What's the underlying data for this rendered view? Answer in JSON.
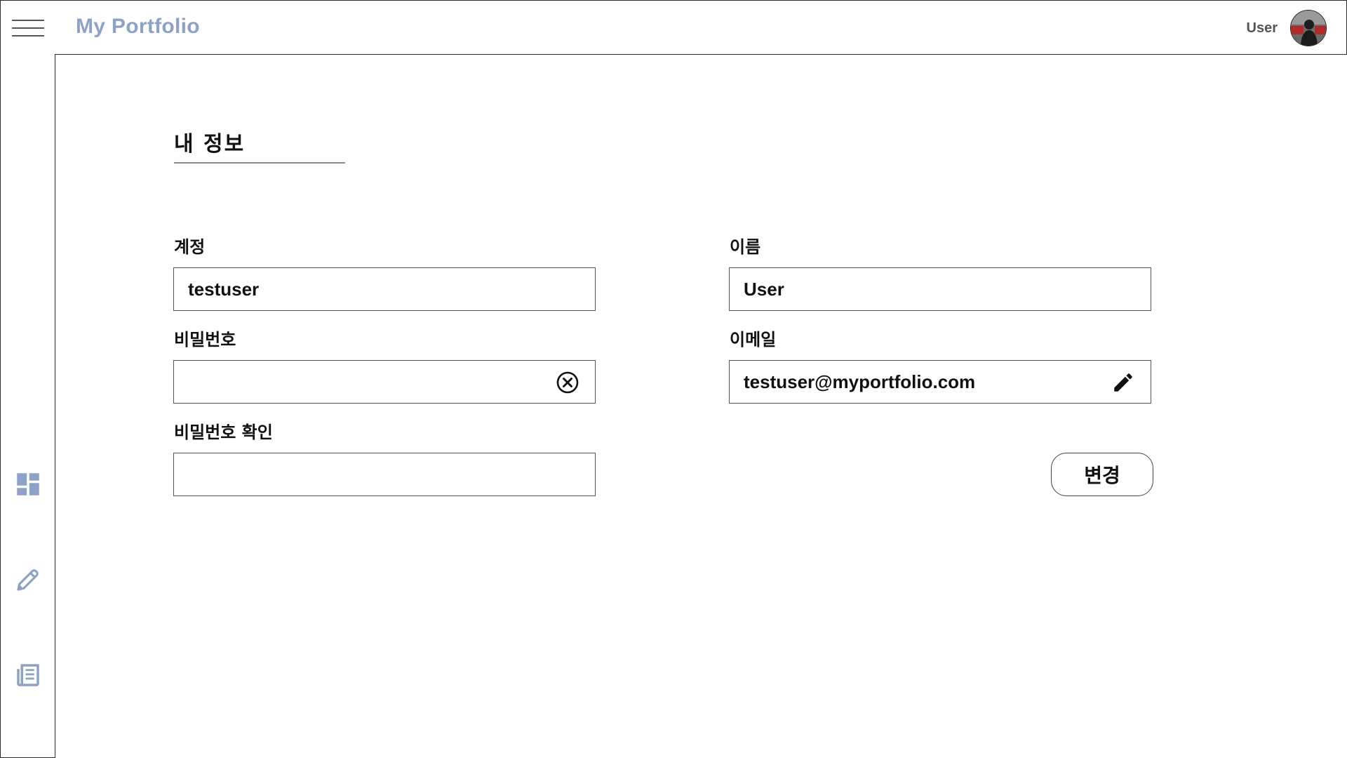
{
  "header": {
    "brand": "My Portfolio",
    "user_name": "User"
  },
  "sidebar": {
    "items": [
      {
        "icon": "dashboard-icon"
      },
      {
        "icon": "edit-icon"
      },
      {
        "icon": "article-icon"
      }
    ]
  },
  "main": {
    "title": "내 정보",
    "fields": {
      "account": {
        "label": "계정",
        "value": "testuser"
      },
      "password": {
        "label": "비밀번호",
        "value": ""
      },
      "password_confirm": {
        "label": "비밀번호 확인",
        "value": ""
      },
      "name": {
        "label": "이름",
        "value": "User"
      },
      "email": {
        "label": "이메일",
        "value": "testuser@myportfolio.com"
      }
    },
    "submit_label": "변경"
  },
  "colors": {
    "brand": "#8da2c6",
    "icon": "#8da2c6"
  }
}
